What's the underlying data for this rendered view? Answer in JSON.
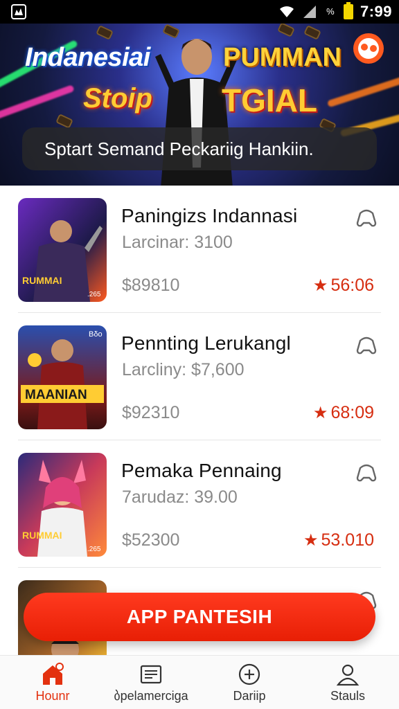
{
  "status_bar": {
    "percent_label": "%",
    "time": "7:99"
  },
  "hero": {
    "title_left": "Indanesiai",
    "title_right": "PUMMAN",
    "subtitle_left": "Stoip",
    "subtitle_right": "TGIAL",
    "caption": "Sptart Semand Peckariig Hankiin."
  },
  "games": [
    {
      "title": "Paningizs Indannasi",
      "subtitle": "Larcinar: 3100",
      "price": "$89810",
      "rating": "56:06",
      "thumb_text": "RUMMAI",
      "thumb_corner": ".265",
      "thumb_colors": [
        "#6a2bbf",
        "#1e1a4a",
        "#ff5a1f"
      ]
    },
    {
      "title": "Pennting Lerukangl",
      "subtitle": "Larcliny: $7,600",
      "price": "$92310",
      "rating": "68:09",
      "thumb_text": "MAANIAN",
      "thumb_corner": "Bδo",
      "thumb_colors": [
        "#2a4fae",
        "#7a1a1a",
        "#ffcc33"
      ]
    },
    {
      "title": "Pemaka Pennaing",
      "subtitle": "7arudaz: 39.00",
      "price": "$52300",
      "rating": "53.010",
      "thumb_text": "RUMMAI",
      "thumb_corner": ".265",
      "thumb_colors": [
        "#2b2a7a",
        "#c83a5a",
        "#ff8a3a"
      ]
    },
    {
      "thumb_colors": [
        "#3a2a1a",
        "#b06a2a",
        "#ffcc33"
      ]
    }
  ],
  "cta": {
    "label": "APP PANTESIH"
  },
  "bottom_nav": [
    {
      "label": "Hounr",
      "icon": "home-icon",
      "active": true
    },
    {
      "label": "ბpelamerciga",
      "icon": "newspaper-icon",
      "active": false
    },
    {
      "label": "Dariip",
      "icon": "plus-circle-icon",
      "active": false
    },
    {
      "label": "Stauls",
      "icon": "user-icon",
      "active": false
    }
  ],
  "colors": {
    "accent": "#e81f05",
    "rating": "#d62d10",
    "muted_text": "#8a8a8a"
  }
}
